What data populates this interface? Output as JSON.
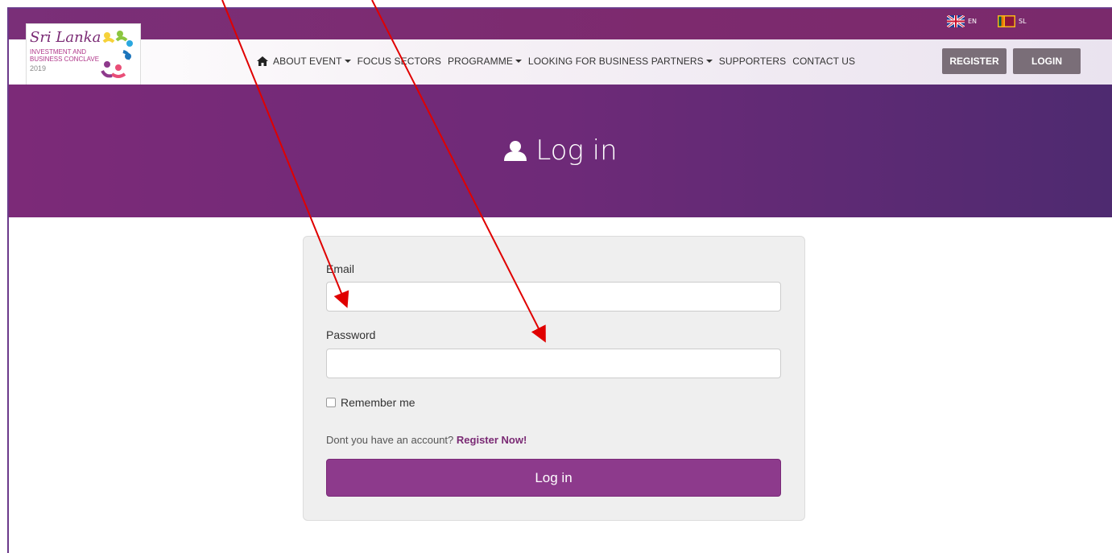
{
  "header": {
    "languages": [
      {
        "code": "EN",
        "flag": "uk-flag-icon"
      },
      {
        "code": "SL",
        "flag": "sri-lanka-flag-icon"
      }
    ],
    "logo": {
      "line1": "Sri Lanka",
      "line2": "INVESTMENT AND",
      "line3": "BUSINESS CONCLAVE",
      "line4": "2019"
    },
    "nav": {
      "home_icon": "home-icon",
      "items": [
        {
          "label": "ABOUT EVENT",
          "dropdown": true
        },
        {
          "label": "FOCUS SECTORS",
          "dropdown": false
        },
        {
          "label": "PROGRAMME",
          "dropdown": true
        },
        {
          "label": "LOOKING FOR BUSINESS PARTNERS",
          "dropdown": true
        },
        {
          "label": "SUPPORTERS",
          "dropdown": false
        },
        {
          "label": "CONTACT US",
          "dropdown": false
        }
      ],
      "register_label": "REGISTER",
      "login_label": "LOGIN"
    }
  },
  "hero": {
    "icon": "user-icon",
    "title": "Log in"
  },
  "form": {
    "email_label": "Email",
    "email_value": "",
    "password_label": "Password",
    "password_value": "",
    "remember_label": "Remember me",
    "account_prompt": "Dont you have an account?",
    "register_link": "Register Now!",
    "submit_label": "Log in"
  },
  "colors": {
    "brand_purple": "#7c2a78",
    "button_purple": "#8d3a8c",
    "nav_button_gray": "#7a6e78",
    "annotation_red": "#e00000"
  }
}
